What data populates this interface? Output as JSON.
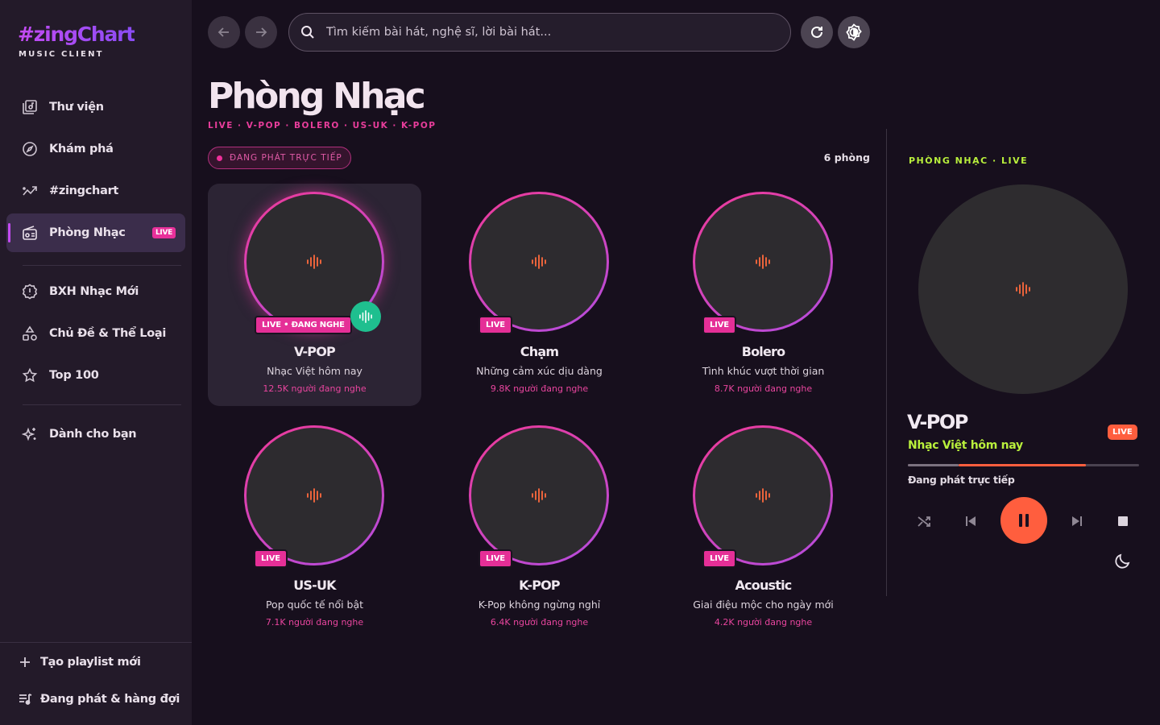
{
  "app": {
    "logo_title": "#zingChart",
    "logo_subtitle": "MUSIC CLIENT"
  },
  "sidebar": {
    "items": [
      {
        "label": "Thư viện",
        "icon": "library-icon"
      },
      {
        "label": "Khám phá",
        "icon": "compass-icon"
      },
      {
        "label": "#zingchart",
        "icon": "trend-chart-icon"
      },
      {
        "label": "Phòng Nhạc",
        "icon": "radio-icon",
        "tag": "LIVE",
        "active": true
      },
      {
        "label": "BXH Nhạc Mới",
        "icon": "badge-new-icon"
      },
      {
        "label": "Chủ Đề & Thể Loại",
        "icon": "shapes-icon"
      },
      {
        "label": "Top 100",
        "icon": "star-icon"
      },
      {
        "label": "Dành cho bạn",
        "icon": "sparkle-icon"
      }
    ],
    "bottom": [
      {
        "label": "Tạo playlist mới",
        "icon": "plus-icon"
      },
      {
        "label": "Đang phát & hàng đợi",
        "icon": "queue-icon"
      }
    ]
  },
  "topbar": {
    "search_placeholder": "Tìm kiếm bài hát, nghệ sĩ, lời bài hát..."
  },
  "main": {
    "title": "Phòng Nhạc",
    "subtitle": "LIVE · V-POP · BOLERO · US-UK · K-POP",
    "live_pill": "ĐANG PHÁT TRỰC TIẾP",
    "room_count": "6 phòng",
    "rooms": [
      {
        "name": "V-POP",
        "desc": "Nhạc Việt hôm nay",
        "listeners": "12.5K người đang nghe",
        "badge": "LIVE • ĐANG NGHE",
        "selected": true
      },
      {
        "name": "Chạm",
        "desc": "Những cảm xúc dịu dàng",
        "listeners": "9.8K người đang nghe",
        "badge": "LIVE"
      },
      {
        "name": "Bolero",
        "desc": "Tình khúc vượt thời gian",
        "listeners": "8.7K người đang nghe",
        "badge": "LIVE"
      },
      {
        "name": "US-UK",
        "desc": "Pop quốc tế nổi bật",
        "listeners": "7.1K người đang nghe",
        "badge": "LIVE"
      },
      {
        "name": "K-POP",
        "desc": "K-Pop không ngừng nghỉ",
        "listeners": "6.4K người đang nghe",
        "badge": "LIVE"
      },
      {
        "name": "Acoustic",
        "desc": "Giai điệu mộc cho ngày mới",
        "listeners": "4.2K người đang nghe",
        "badge": "LIVE"
      }
    ]
  },
  "now_playing": {
    "label": "PHÒNG NHẠC · LIVE",
    "title": "V-POP",
    "subtitle": "Nhạc Việt hôm nay",
    "live": "LIVE",
    "status": "Đang phát trực tiếp",
    "progress_start": 0.22,
    "progress_end": 0.77
  },
  "colors": {
    "accent_pink": "#e52f97",
    "accent_purple": "#c44bf2",
    "accent_orange": "#ff5e3e",
    "accent_lime": "#b9f03c",
    "playing_green": "#1fbf8f"
  }
}
